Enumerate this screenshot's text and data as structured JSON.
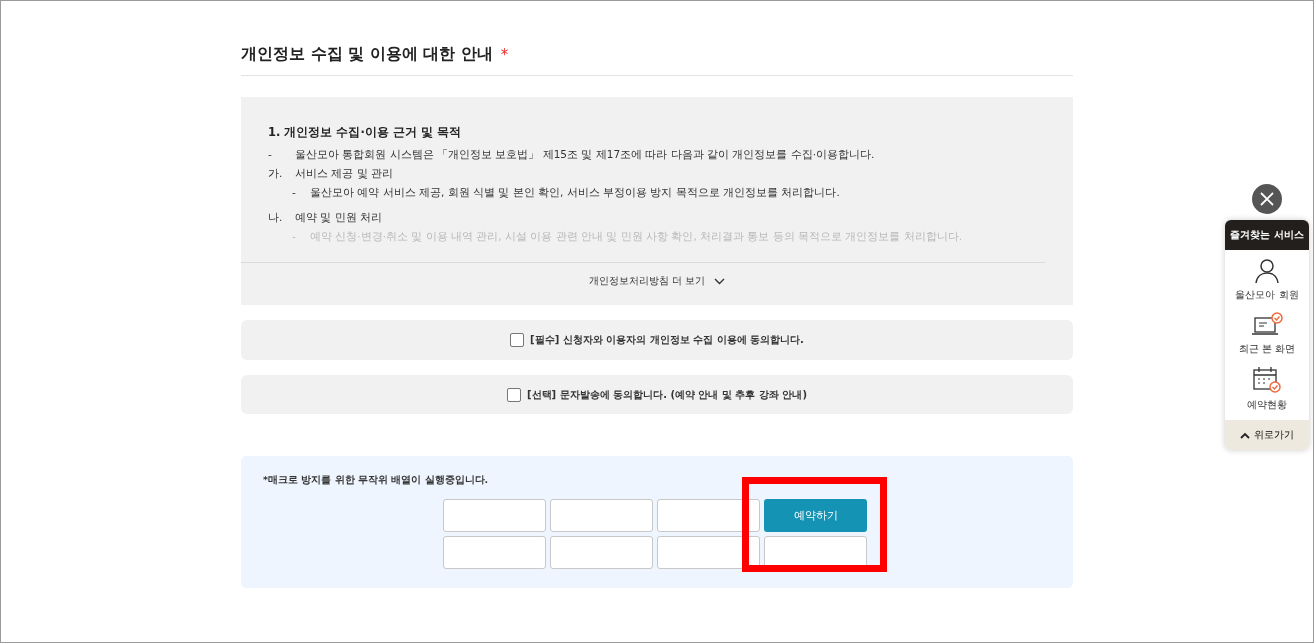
{
  "section": {
    "title": "개인정보 수집 및 이용에 대한 안내",
    "required_mark": "*"
  },
  "policy": {
    "heading": "1. 개인정보 수집·이용 근거 및 목적",
    "lines": [
      {
        "kind": "dash",
        "marker": "-",
        "text": "울산모아 통합회원 시스템은 「개인정보 보호법」 제15조 및 제17조에 따라 다음과 같이 개인정보를 수집·이용합니다.",
        "faded": false
      },
      {
        "kind": "item",
        "marker": "가.",
        "text": "서비스 제공 및 관리",
        "faded": false
      },
      {
        "kind": "subdash",
        "marker": "-",
        "text": "울산모아 예약 서비스 제공, 회원 식별 및 본인 확인, 서비스 부정이용 방지 목적으로 개인정보를 처리합니다.",
        "faded": false
      },
      {
        "kind": "item",
        "marker": "나.",
        "text": "예약 및 민원 처리",
        "faded": false
      },
      {
        "kind": "subdash",
        "marker": "-",
        "text": "예약 신청·변경·취소 및 이용 내역 관리, 시설 이용 관련 안내 및 민원 사항 확인, 처리결과 통보 등의 목적으로 개인정보를 처리합니다.",
        "faded": true
      }
    ],
    "more_label": "개인정보처리방침 더 보기"
  },
  "consents": [
    {
      "label": "[필수] 신청자와 이용자의 개인정보 수집 이용에 동의합니다.",
      "checked": false
    },
    {
      "label": "[선택] 문자발송에 동의합니다. (예약 안내 및 추후 강좌 안내)",
      "checked": false
    }
  ],
  "booking": {
    "notice": "*매크로 방지를 위한 무작위 배열이 실행중입니다.",
    "cells": [
      {
        "kind": "blank"
      },
      {
        "kind": "blank"
      },
      {
        "kind": "blank"
      },
      {
        "kind": "button",
        "label": "예약하기",
        "highlighted": true
      },
      {
        "kind": "blank"
      },
      {
        "kind": "blank"
      },
      {
        "kind": "blank"
      },
      {
        "kind": "blank"
      }
    ]
  },
  "quick_menu": {
    "header": "즐겨찾는 서비스",
    "items": [
      {
        "kind": "person",
        "label": "울산모아 회원"
      },
      {
        "kind": "laptop",
        "label": "최근 본 화면"
      },
      {
        "kind": "calendar",
        "label": "예약현황"
      }
    ],
    "top_label": "위로가기"
  }
}
